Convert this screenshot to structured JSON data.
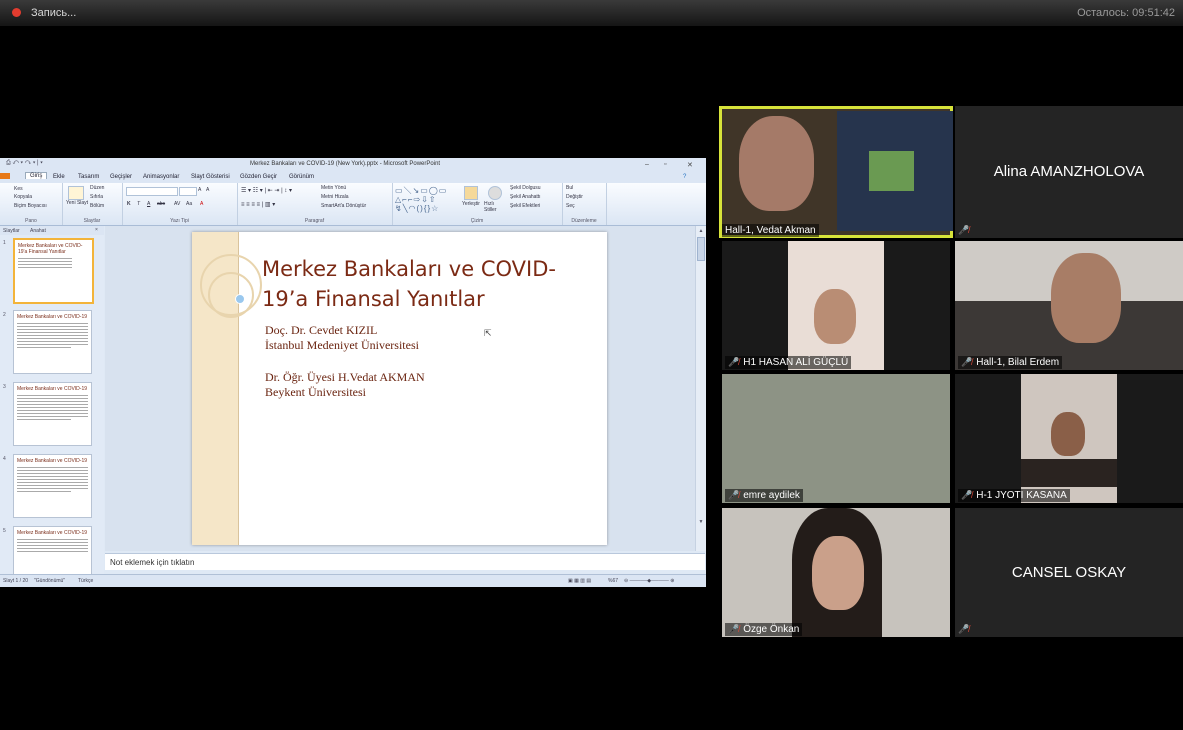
{
  "recording": {
    "label": "Запись...",
    "remaining": "Осталось: 09:51:42"
  },
  "powerpoint": {
    "window_title": "Merkez Bankaları ve COVID-19 (New York).pptx - Microsoft PowerPoint",
    "quick_access": "⎙ ↶ ▾ ↷ ▾ | ▾",
    "tabs": [
      "Giriş",
      "Ekle",
      "Tasarım",
      "Geçişler",
      "Animasyonlar",
      "Slayt Gösterisi",
      "Gözden Geçir",
      "Görünüm"
    ],
    "ribbon": {
      "clipboard": {
        "cut": "Kes",
        "copy": "Kopyala",
        "format_painter": "Biçim Boyacısı",
        "label": "Pano"
      },
      "slides": {
        "new_slide": "Yeni Slayt",
        "layout": "Düzen",
        "reset": "Sıfırla",
        "section": "Bölüm",
        "label": "Slaytlar"
      },
      "font": {
        "bold": "K",
        "italic": "T",
        "underline": "A",
        "strike": "abc",
        "spacing": "AV",
        "case": "Aa",
        "grow": "A",
        "shrink": "A",
        "color": "A",
        "label": "Yazı Tipi"
      },
      "paragraph": {
        "text_direction": "Metin Yönü",
        "align_text": "Metni Hizala",
        "smartart": "SmartArt'a Dönüştür",
        "label": "Paragraf"
      },
      "drawing": {
        "arrange": "Yerleştir",
        "quick_styles": "Hızlı Stiller",
        "fill": "Şekil Dolgusu",
        "outline": "Şekil Anahattı",
        "effects": "Şekil Efektleri",
        "label": "Çizim"
      },
      "editing": {
        "find": "Bul",
        "replace": "Değiştir",
        "select": "Seç",
        "label": "Düzenleme"
      }
    },
    "panel_tabs": {
      "slides": "Slaytlar",
      "outline": "Anahat"
    },
    "thumbnails": [
      {
        "num": "1",
        "title": "Merkez Bankaları ve COVID-19'a Finansal Yanıtlar",
        "lines": 5
      },
      {
        "num": "2",
        "title": "Merkez Bankaları ve COVID-19",
        "lines": 12
      },
      {
        "num": "3",
        "title": "Merkez Bankaları ve COVID-19",
        "lines": 11
      },
      {
        "num": "4",
        "title": "Merkez Bankaları ve COVID-19",
        "lines": 11
      },
      {
        "num": "5",
        "title": "Merkez Bankaları ve COVID-19",
        "lines": 6
      }
    ],
    "slide": {
      "title": "Merkez Bankaları ve COVID-19’a Finansal Yanıtlar",
      "author1_name": "Doç. Dr. Cevdet KIZIL",
      "author1_affiliation": "İstanbul Medeniyet Üniversitesi",
      "author2_name": "Dr. Öğr. Üyesi H.Vedat AKMAN",
      "author2_affiliation": "Beykent Üniversitesi"
    },
    "notes_placeholder": "Not eklemek için tıklatın",
    "status": {
      "slide": "Slayt 1 / 20",
      "theme": "\"Gündönümü\"",
      "language": "Türkçe",
      "zoom": "%67"
    }
  },
  "participants": [
    {
      "name": "Hall-1, Vedat Akman",
      "muted": false,
      "active": true,
      "video": true
    },
    {
      "name": "Alina AMANZHOLOVA",
      "muted": true,
      "active": false,
      "video": false
    },
    {
      "name": "H1 HASAN ALİ GÜÇLÜ",
      "muted": true,
      "active": false,
      "video": true
    },
    {
      "name": "Hall-1, Bilal Erdem",
      "muted": true,
      "active": false,
      "video": true
    },
    {
      "name": "emre aydilek",
      "muted": true,
      "active": false,
      "video": true
    },
    {
      "name": "H-1 JYOTI KASANA",
      "muted": true,
      "active": false,
      "video": true
    },
    {
      "name": "Özge Önkan",
      "muted": true,
      "active": false,
      "video": true
    },
    {
      "name": "CANSEL OSKAY",
      "muted": true,
      "active": false,
      "video": false
    }
  ],
  "icons": {
    "mic_muted": "🎤̸",
    "recording": "record-dot"
  }
}
